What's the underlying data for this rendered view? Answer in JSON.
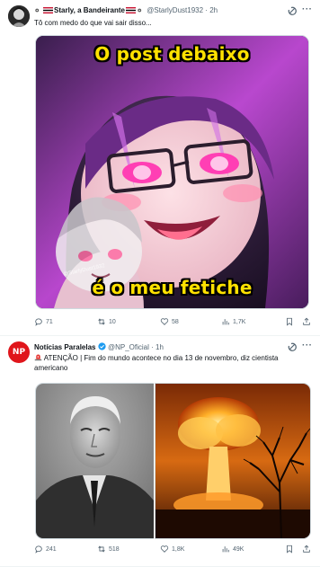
{
  "posts": [
    {
      "display_name": "Starly, a Bandeirante",
      "handle": "@StarlyDust1932",
      "time": "2h",
      "text": "Tô com medo do que vai sair disso...",
      "meme_top": "O post debaixo",
      "meme_bottom": "é o meu fetiche",
      "watermark": "@StarlyDust1932",
      "replies": "71",
      "reposts": "10",
      "likes": "58",
      "views": "1,7K"
    },
    {
      "avatar_text": "NP",
      "display_name": "Notícias Paralelas",
      "handle": "@NP_Oficial",
      "time": "1h",
      "text": "ATENÇÃO | Fim do mundo acontece no dia 13 de novembro, diz cientista americano",
      "replies": "241",
      "reposts": "518",
      "likes": "1,8K",
      "views": "49K"
    }
  ],
  "colors": {
    "verified": "#1d9bf0",
    "np_brand": "#e0151b",
    "muted": "#536471",
    "meme_text": "#ffe100"
  },
  "icons": [
    "grok-icon",
    "more-icon",
    "reply-icon",
    "repost-icon",
    "like-icon",
    "views-icon",
    "bookmark-icon",
    "share-icon",
    "siren-icon",
    "verified-badge-icon",
    "flag-icon"
  ]
}
